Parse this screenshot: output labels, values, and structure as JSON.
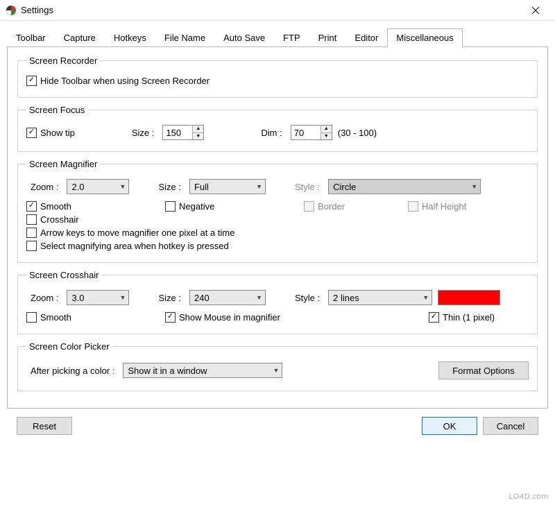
{
  "window": {
    "title": "Settings"
  },
  "tabs": [
    "Toolbar",
    "Capture",
    "Hotkeys",
    "File Name",
    "Auto Save",
    "FTP",
    "Print",
    "Editor",
    "Miscellaneous"
  ],
  "active_tab": "Miscellaneous",
  "screen_recorder": {
    "legend": "Screen Recorder",
    "hide_toolbar": {
      "label": "Hide Toolbar when using Screen Recorder",
      "checked": true
    }
  },
  "screen_focus": {
    "legend": "Screen Focus",
    "show_tip": {
      "label": "Show tip",
      "checked": true
    },
    "size_label": "Size :",
    "size_value": "150",
    "dim_label": "Dim :",
    "dim_value": "70",
    "dim_range": "(30 - 100)"
  },
  "screen_magnifier": {
    "legend": "Screen Magnifier",
    "zoom_label": "Zoom :",
    "zoom_value": "2.0",
    "size_label": "Size :",
    "size_value": "Full",
    "style_label": "Style :",
    "style_value": "Circle",
    "smooth": {
      "label": "Smooth",
      "checked": true
    },
    "negative": {
      "label": "Negative",
      "checked": false
    },
    "border": {
      "label": "Border",
      "checked": false,
      "disabled": true
    },
    "half_height": {
      "label": "Half Height",
      "checked": false,
      "disabled": true
    },
    "crosshair": {
      "label": "Crosshair",
      "checked": false
    },
    "arrow_keys": {
      "label": "Arrow keys to move magnifier one pixel at a time",
      "checked": false
    },
    "select_area": {
      "label": "Select magnifying area when hotkey is pressed",
      "checked": false
    }
  },
  "screen_crosshair": {
    "legend": "Screen Crosshair",
    "zoom_label": "Zoom :",
    "zoom_value": "3.0",
    "size_label": "Size :",
    "size_value": "240",
    "style_label": "Style :",
    "style_value": "2 lines",
    "color": "#ff0000",
    "smooth": {
      "label": "Smooth",
      "checked": false
    },
    "show_mouse": {
      "label": "Show Mouse in magnifier",
      "checked": true
    },
    "thin": {
      "label": "Thin (1 pixel)",
      "checked": true
    }
  },
  "screen_color_picker": {
    "legend": "Screen Color Picker",
    "after_label": "After picking a color :",
    "after_value": "Show it in a window",
    "format_button": "Format Options"
  },
  "buttons": {
    "reset": "Reset",
    "ok": "OK",
    "cancel": "Cancel"
  },
  "watermark": "LO4D.com"
}
